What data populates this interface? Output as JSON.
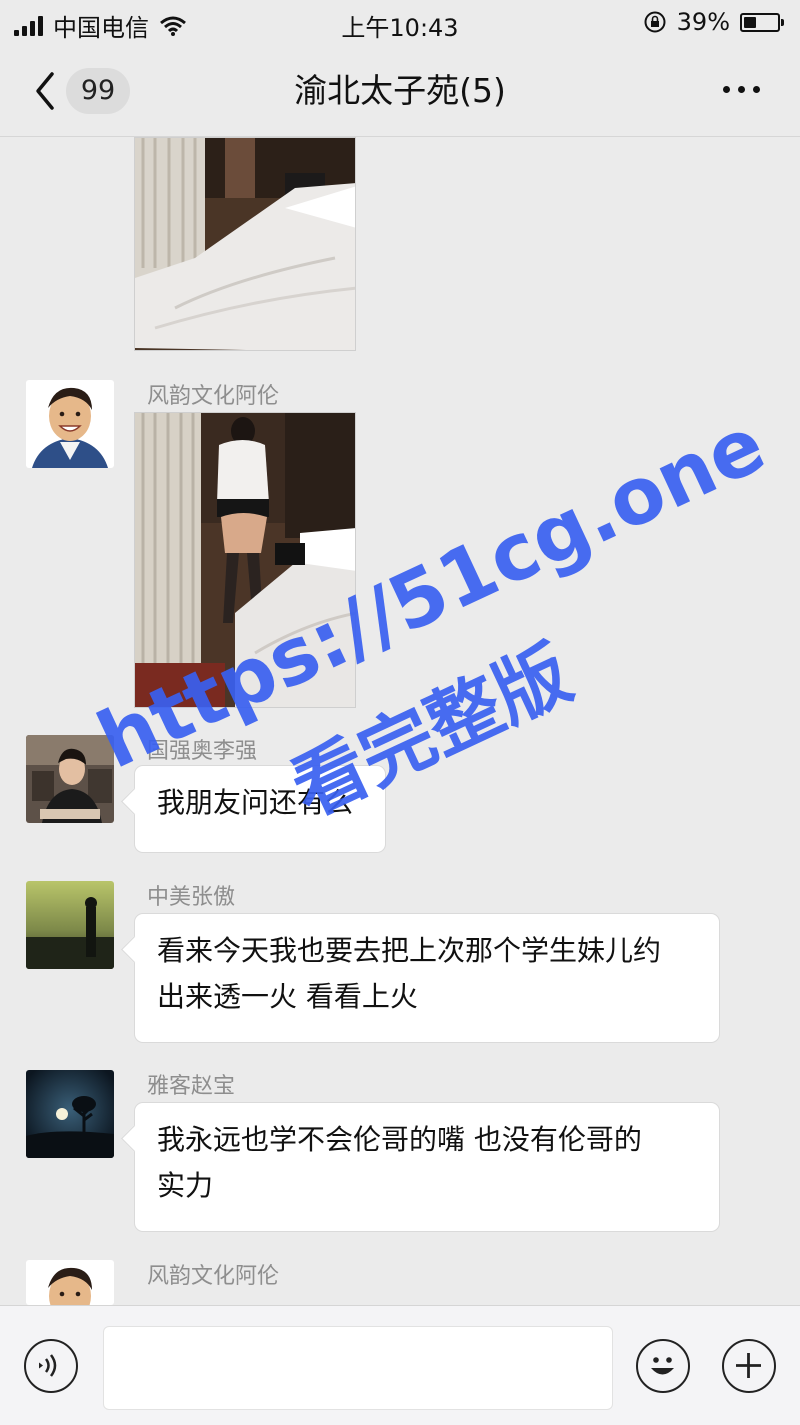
{
  "status_bar": {
    "carrier": "中国电信",
    "time": "上午10:43",
    "battery": "39%",
    "battery_level": 0.39
  },
  "nav": {
    "unread_badge": "99",
    "title": "渝北太子苑(5)"
  },
  "messages": [
    {
      "type": "image",
      "sender": "",
      "description": "hotel-photo-1"
    },
    {
      "type": "image",
      "sender": "风韵文化阿伦"
    },
    {
      "type": "text",
      "sender": "国强奥李强",
      "text": "我朋友问还有么"
    },
    {
      "type": "text",
      "sender": "中美张傲",
      "line1": "看来今天我也要去把上次那个学生妹儿约",
      "line2": "出来透一火 看看上火"
    },
    {
      "type": "text",
      "sender": "雅客赵宝",
      "line1": "我永远也学不会伦哥的嘴 也没有伦哥的",
      "line2": "实力"
    },
    {
      "type": "partial",
      "sender": "风韵文化阿伦"
    }
  ],
  "watermark": {
    "url": "https://51cg.one",
    "caption": "看完整版"
  },
  "colors": {
    "background": "#ebebeb",
    "watermark": "#385ff0",
    "bubble": "#ffffff"
  },
  "icons": [
    "wifi-icon",
    "lock-rotation-icon",
    "back-chevron-icon",
    "more-dots-icon",
    "voice-icon",
    "emoji-icon",
    "plus-icon"
  ]
}
